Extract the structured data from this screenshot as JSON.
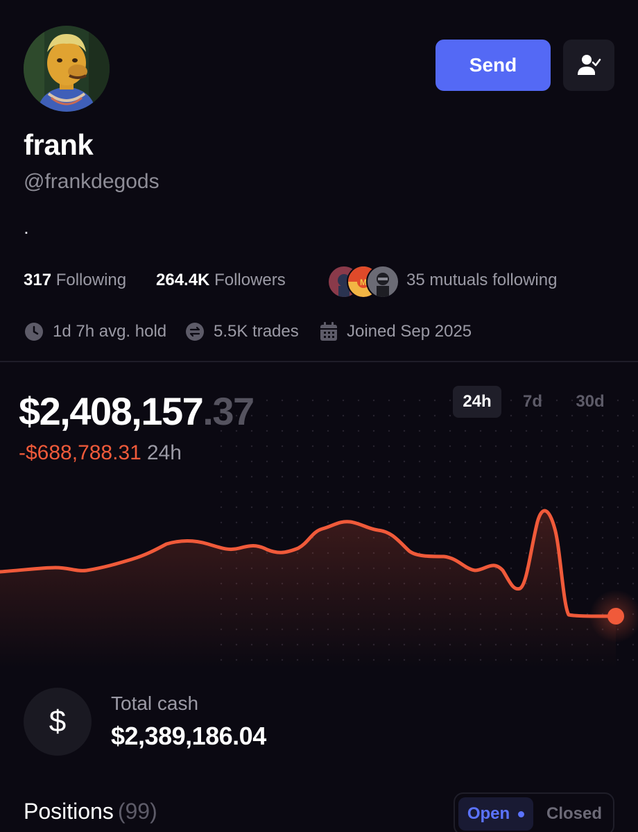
{
  "profile": {
    "display_name": "frank",
    "handle": "@frankdegods",
    "bio": "."
  },
  "header": {
    "send_label": "Send",
    "follow_icon": "user-check-icon"
  },
  "stats": {
    "following_count": "317",
    "following_label": "Following",
    "followers_count": "264.4K",
    "followers_label": "Followers",
    "mutuals_text": "35 mutuals following"
  },
  "meta": {
    "avg_hold": "1d 7h avg. hold",
    "trades": "5.5K trades",
    "joined": "Joined Sep 2025"
  },
  "portfolio": {
    "balance_main": "$2,408,157",
    "balance_cents": ".37",
    "change_amount": "-$688,788.31",
    "change_period": "24h",
    "ranges": [
      "24h",
      "7d",
      "30d"
    ],
    "active_range": "24h",
    "accent_color": "#f05a3a"
  },
  "cash": {
    "label": "Total cash",
    "value": "$2,389,186.04",
    "icon_glyph": "$"
  },
  "positions": {
    "title": "Positions",
    "count": "(99)",
    "open_label": "Open",
    "closed_label": "Closed"
  },
  "colors": {
    "background": "#0b0912",
    "primary_button": "#5469f5",
    "negative": "#f05a3a"
  }
}
